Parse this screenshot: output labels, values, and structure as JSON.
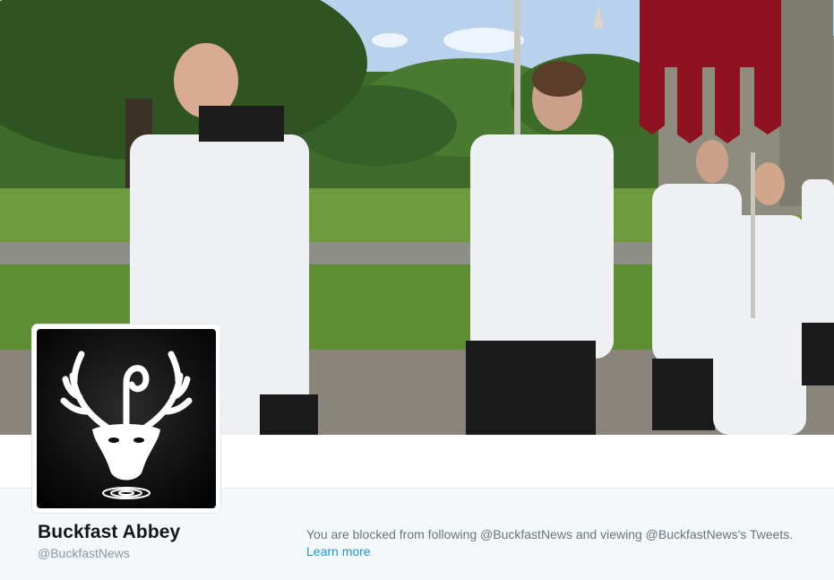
{
  "profile": {
    "display_name": "Buckfast Abbey",
    "screen_name": "@BuckfastNews"
  },
  "blocked_notice": {
    "message": "You are blocked from following @BuckfastNews and viewing @BuckfastNews's Tweets.",
    "learn_more_label": "Learn more"
  },
  "colors": {
    "link": "#1b95e0",
    "name": "#14171a",
    "muted": "#8899a6",
    "bar_bg": "#f5f8fa"
  },
  "icons": {
    "avatar": "stag-crozier-logo-icon"
  }
}
